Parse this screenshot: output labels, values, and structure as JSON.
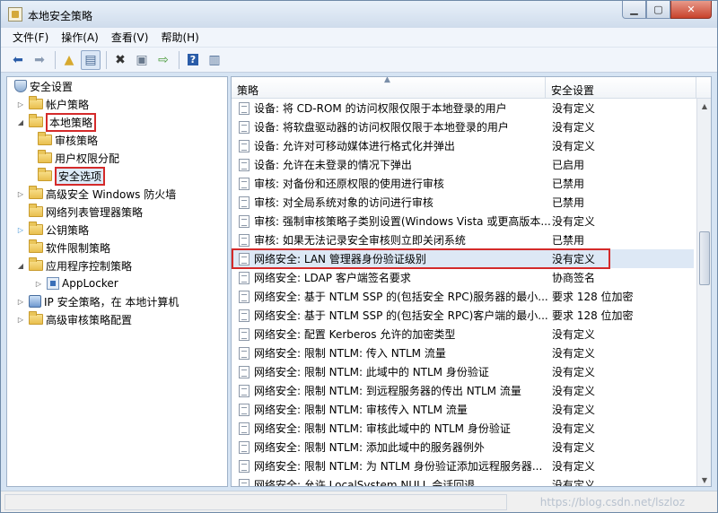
{
  "window": {
    "title": "本地安全策略"
  },
  "menu": [
    "文件(F)",
    "操作(A)",
    "查看(V)",
    "帮助(H)"
  ],
  "tree": {
    "root": "安全设置",
    "items": [
      {
        "label": "帐户策略"
      },
      {
        "label": "本地策略"
      },
      {
        "label": "审核策略"
      },
      {
        "label": "用户权限分配"
      },
      {
        "label": "安全选项"
      },
      {
        "label": "高级安全 Windows 防火墙"
      },
      {
        "label": "网络列表管理器策略"
      },
      {
        "label": "公钥策略"
      },
      {
        "label": "软件限制策略"
      },
      {
        "label": "应用程序控制策略"
      },
      {
        "label": "AppLocker"
      },
      {
        "label": "IP 安全策略，在 本地计算机"
      },
      {
        "label": "高级审核策略配置"
      }
    ]
  },
  "table": {
    "columns": [
      "策略",
      "安全设置"
    ],
    "rows": [
      {
        "policy": "设备: 将 CD-ROM 的访问权限仅限于本地登录的用户",
        "setting": "没有定义"
      },
      {
        "policy": "设备: 将软盘驱动器的访问权限仅限于本地登录的用户",
        "setting": "没有定义"
      },
      {
        "policy": "设备: 允许对可移动媒体进行格式化并弹出",
        "setting": "没有定义"
      },
      {
        "policy": "设备: 允许在未登录的情况下弹出",
        "setting": "已启用"
      },
      {
        "policy": "审核: 对备份和还原权限的使用进行审核",
        "setting": "已禁用"
      },
      {
        "policy": "审核: 对全局系统对象的访问进行审核",
        "setting": "已禁用"
      },
      {
        "policy": "审核: 强制审核策略子类别设置(Windows Vista 或更高版本...",
        "setting": "没有定义"
      },
      {
        "policy": "审核: 如果无法记录安全审核则立即关闭系统",
        "setting": "已禁用"
      },
      {
        "policy": "网络安全: LAN 管理器身份验证级别",
        "setting": "没有定义"
      },
      {
        "policy": "网络安全: LDAP 客户端签名要求",
        "setting": "协商签名"
      },
      {
        "policy": "网络安全: 基于 NTLM SSP 的(包括安全 RPC)服务器的最小...",
        "setting": "要求 128 位加密"
      },
      {
        "policy": "网络安全: 基于 NTLM SSP 的(包括安全 RPC)客户端的最小...",
        "setting": "要求 128 位加密"
      },
      {
        "policy": "网络安全: 配置 Kerberos 允许的加密类型",
        "setting": "没有定义"
      },
      {
        "policy": "网络安全: 限制 NTLM: 传入 NTLM 流量",
        "setting": "没有定义"
      },
      {
        "policy": "网络安全: 限制 NTLM: 此域中的 NTLM 身份验证",
        "setting": "没有定义"
      },
      {
        "policy": "网络安全: 限制 NTLM: 到远程服务器的传出 NTLM 流量",
        "setting": "没有定义"
      },
      {
        "policy": "网络安全: 限制 NTLM: 审核传入 NTLM 流量",
        "setting": "没有定义"
      },
      {
        "policy": "网络安全: 限制 NTLM: 审核此域中的 NTLM 身份验证",
        "setting": "没有定义"
      },
      {
        "policy": "网络安全: 限制 NTLM: 添加此域中的服务器例外",
        "setting": "没有定义"
      },
      {
        "policy": "网络安全: 限制 NTLM: 为 NTLM 身份验证添加远程服务器...",
        "setting": "没有定义"
      },
      {
        "policy": "网络安全: 允许 LocalSystem NULL 会话回退",
        "setting": "没有定义"
      }
    ]
  },
  "watermark": "https://blog.csdn.net/lszloz"
}
